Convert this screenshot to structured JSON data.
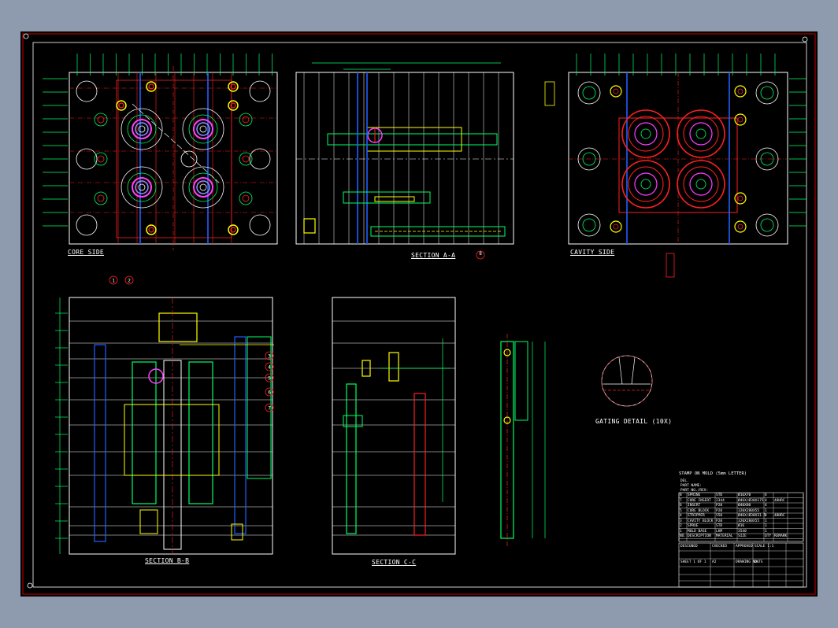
{
  "labels": {
    "core_side": "CORE SIDE",
    "section_aa": "SECTION A-A",
    "cavity_side": "CAVITY SIDE",
    "section_bb": "SECTION B-B",
    "section_cc": "SECTION C-C",
    "gating_detail": "GATING DETAIL (10X)"
  },
  "balloons": [
    "1",
    "2",
    "3",
    "4",
    "5",
    "6",
    "7",
    "8"
  ],
  "title_block": {
    "heading": "STAMP ON MOLD (5mm LETTER)",
    "line1": "PART NAME:",
    "line2": "PART NO./REV:",
    "line3": "DEL.",
    "header": [
      "NO.",
      "DESCRIPTION",
      "MATERIAL",
      "SIZE",
      "QTY",
      "REMARK"
    ],
    "rows": [
      {
        "no": "8",
        "desc": "SPRING",
        "mat": "STD",
        "size": "Ø16X70",
        "qty": "4",
        "rem": ""
      },
      {
        "no": "7",
        "desc": "CORE INSERT",
        "mat": "2344",
        "size": "Ø46X/Ø38X175",
        "qty": "4",
        "rem": "48HRC"
      },
      {
        "no": "6",
        "desc": "INSERT",
        "mat": "P20",
        "size": "Ø40X80",
        "qty": "4",
        "rem": ""
      },
      {
        "no": "5",
        "desc": "CORE BLOCK",
        "mat": "P20",
        "size": "320X280X55",
        "qty": "1",
        "rem": ""
      },
      {
        "no": "4",
        "desc": "STRIPPER",
        "mat": "S50",
        "size": "Ø46X/Ø38X31.5",
        "qty": "4",
        "rem": "48HRC"
      },
      {
        "no": "3",
        "desc": "CAVITY BLOCK",
        "mat": "P20",
        "size": "320X280X55",
        "qty": "1",
        "rem": ""
      },
      {
        "no": "2",
        "desc": "SPRUE",
        "mat": "STD",
        "size": "Ø16",
        "qty": "1",
        "rem": ""
      },
      {
        "no": "1",
        "desc": "MOLD BASE",
        "mat": "LKM",
        "size": "3540",
        "qty": "1",
        "rem": ""
      }
    ],
    "bottom": [
      "DESIGNED",
      "CHECKED",
      "APPROVED",
      "SCALE 1:1",
      "SHEET 1 OF 1",
      "A2",
      "DRAWING NO.",
      "DATE"
    ]
  },
  "colors": {
    "sheet": "#000000",
    "border_outer": "#cc0000",
    "border_inner": "#ffffff",
    "dimension": "#00ff66",
    "center_line": "#ff2020",
    "hidden_line": "#ffff00",
    "cyan": "#00ffff",
    "blue": "#2060ff",
    "magenta": "#ff40ff"
  }
}
